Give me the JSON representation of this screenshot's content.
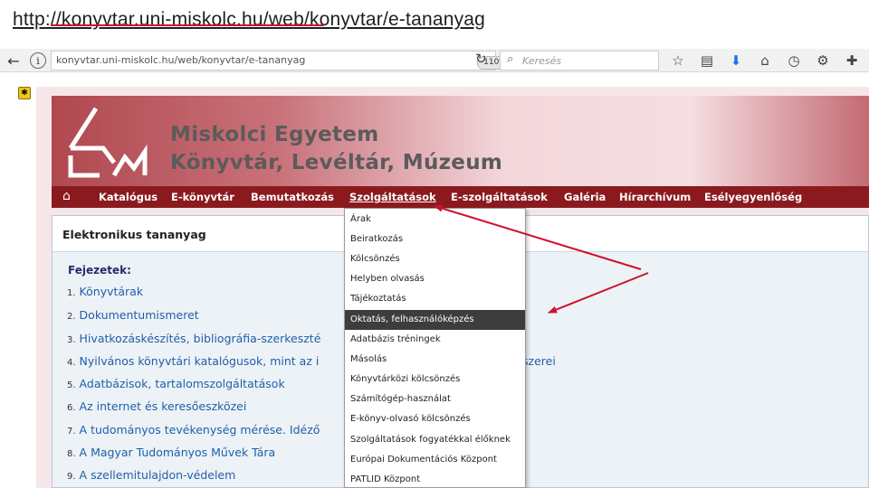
{
  "caption": {
    "url": "http://konyvtar.uni-miskolc.hu/web/konyvtar/e-tananyag"
  },
  "browser": {
    "address": "konyvtar.uni-miskolc.hu/web/konyvtar/e-tananyag",
    "zoom": "110%",
    "search_placeholder": "Keresés",
    "icons": [
      "back-icon",
      "info-icon",
      "reload-icon",
      "search-icon",
      "star-icon",
      "reader-icon",
      "download-icon",
      "home-icon",
      "history-icon",
      "settings-icon",
      "extensions-icon"
    ]
  },
  "banner": {
    "title1": "Miskolci Egyetem",
    "title2": "Könyvtár, Levéltár, Múzeum"
  },
  "nav": {
    "items": [
      {
        "label": "Katalógus"
      },
      {
        "label": "E-könyvtár"
      },
      {
        "label": "Bemutatkozás"
      },
      {
        "label": "Szolgáltatások"
      },
      {
        "label": "E-szolgáltatások"
      },
      {
        "label": "Galéria"
      },
      {
        "label": "Hírarchívum"
      },
      {
        "label": "Esélyegyenlőség"
      }
    ]
  },
  "content": {
    "title": "Elektronikus tananyag",
    "chapters_label": "Fejezetek:",
    "chapters": [
      {
        "num": "1.",
        "text": "Könyvtárak"
      },
      {
        "num": "2.",
        "text": "Dokumentumismeret"
      },
      {
        "num": "3.",
        "text": "Hivatkozáskészítés, bibliográfia-szerkeszté"
      },
      {
        "num": "4.",
        "text": "Nyilvános könyvtári katalógusok, mint az i"
      },
      {
        "num": "5.",
        "text": "Adatbázisok, tartalomszolgáltatások"
      },
      {
        "num": "6.",
        "text": "Az internet és keresőeszközei"
      },
      {
        "num": "7.",
        "text": "A tudományos tevékenység mérése. Idéző"
      },
      {
        "num": "8.",
        "text": "A Magyar Tudományos Művek Tára"
      },
      {
        "num": "9.",
        "text": "A szellemitulajdon-védelem"
      }
    ],
    "overflow_text": "szerei"
  },
  "dropdown": {
    "items": [
      {
        "label": "Árak"
      },
      {
        "label": "Beiratkozás"
      },
      {
        "label": "Kölcsönzés"
      },
      {
        "label": "Helyben olvasás"
      },
      {
        "label": "Tájékoztatás"
      },
      {
        "label": "Oktatás, felhasználóképzés"
      },
      {
        "label": "Adatbázis tréningek"
      },
      {
        "label": "Másolás"
      },
      {
        "label": "Könyvtárközi kölcsönzés"
      },
      {
        "label": "Számítógép-használat"
      },
      {
        "label": "E-könyv-olvasó kölcsönzés"
      },
      {
        "label": "Szolgáltatások fogyatékkal élőknek"
      },
      {
        "label": "Európai Dokumentációs Központ"
      },
      {
        "label": "PATLID Központ"
      }
    ],
    "highlighted": "Oktatás, felhasználóképzés"
  },
  "colors": {
    "nav_bg": "#8b1a1f",
    "annotation_red": "#d0102a",
    "link_blue": "#1f5fa8"
  }
}
